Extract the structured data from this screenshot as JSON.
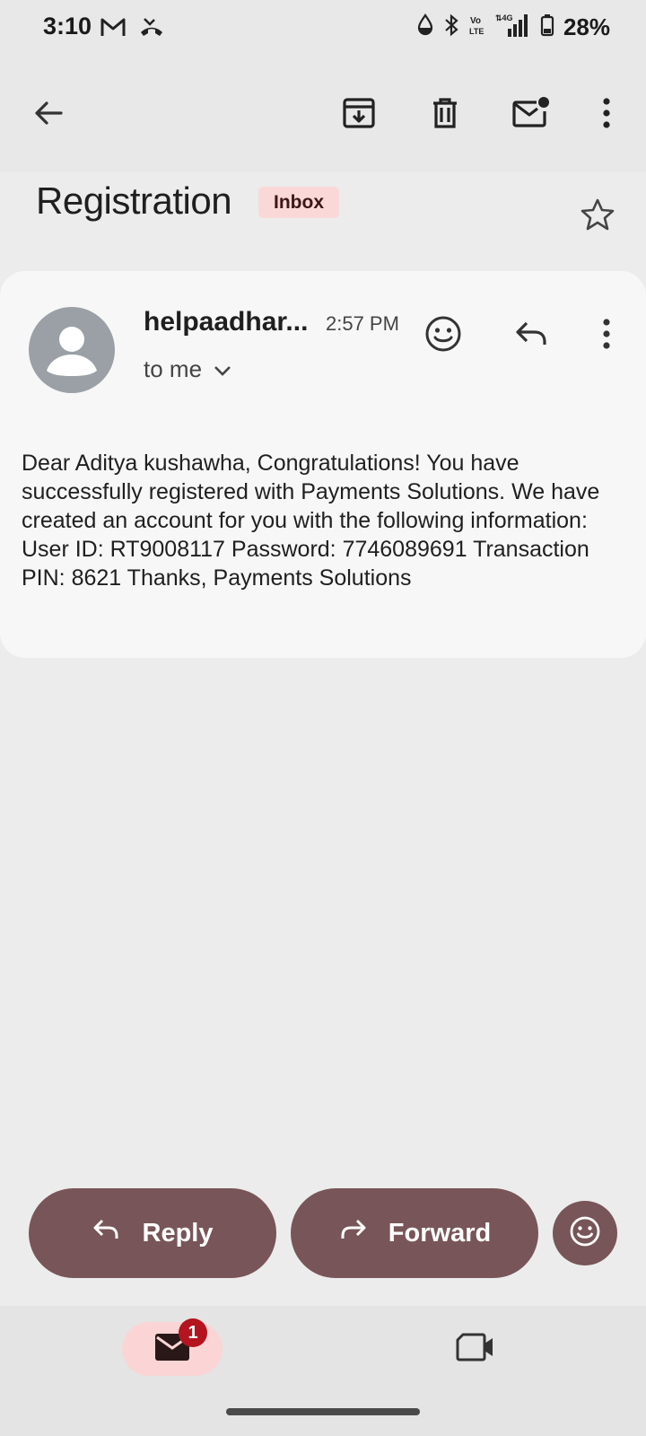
{
  "status_bar": {
    "time": "3:10",
    "battery": "28%",
    "icons": [
      "gmail-icon",
      "missed-call-icon",
      "water-drop-icon",
      "bluetooth-icon",
      "volte-icon",
      "signal-4g-icon",
      "battery-icon"
    ]
  },
  "toolbar": {
    "back_icon": "arrow-back-icon",
    "archive_icon": "archive-icon",
    "delete_icon": "delete-icon",
    "mark_unread_icon": "mark-unread-icon",
    "more_icon": "more-vert-icon"
  },
  "email": {
    "subject": "Registration",
    "label_chip": "Inbox",
    "sender": "helpaadhar...",
    "time": "2:57 PM",
    "recipient": "to me",
    "body": "Dear Aditya kushawha, Congratulations! You have successfully registered with Payments Solutions. We have created an account for you with the following information: User ID: RT9008117 Password: 7746089691 Transaction PIN: 8621 Thanks, Payments Solutions"
  },
  "actions": {
    "reply_label": "Reply",
    "forward_label": "Forward"
  },
  "nav": {
    "mail_badge": "1"
  },
  "colors": {
    "accent_pill": "#785558",
    "chip_bg": "#fad8d8",
    "badge": "#b3141e",
    "background": "#ececec",
    "card": "#f7f7f7"
  }
}
